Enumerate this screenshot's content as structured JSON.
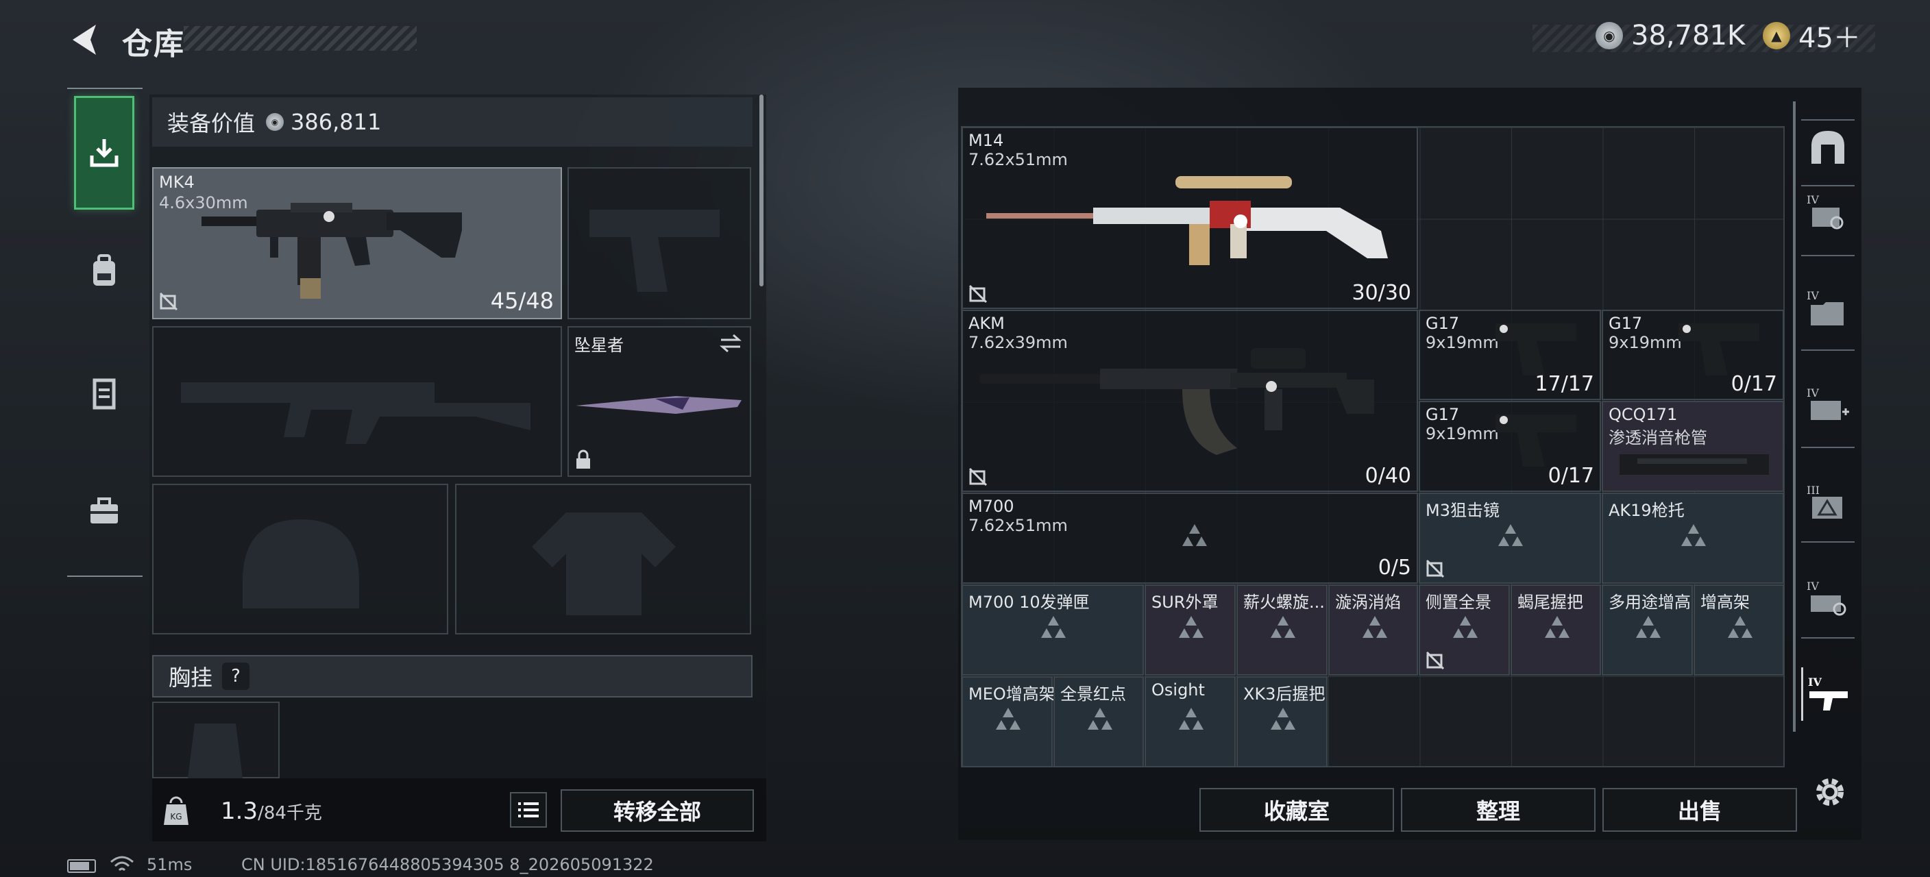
{
  "header": {
    "title": "仓库",
    "currency_a": "38,781K",
    "currency_b": "45＋"
  },
  "left": {
    "equip_value_label": "装备价值",
    "equip_value": "386,811",
    "primary": {
      "name": "MK4",
      "caliber": "4.6x30mm",
      "ammo": "45/48"
    },
    "melee": {
      "name": "坠星者"
    },
    "chest_label": "胸挂",
    "chest_help": "?",
    "weight_current": "1.3",
    "weight_max": "/84千克",
    "transfer_all": "转移全部"
  },
  "right": {
    "items": {
      "m14": {
        "name": "M14",
        "caliber": "7.62x51mm",
        "ammo": "30/30"
      },
      "akm": {
        "name": "AKM",
        "caliber": "7.62x39mm",
        "ammo": "0/40"
      },
      "g17a": {
        "name": "G17",
        "caliber": "9x19mm",
        "ammo": "17/17"
      },
      "g17b": {
        "name": "G17",
        "caliber": "9x19mm",
        "ammo": "0/17"
      },
      "g17c": {
        "name": "G17",
        "caliber": "9x19mm",
        "ammo": "0/17"
      },
      "qcq": {
        "name": "QCQ171",
        "desc": "渗透消音枪管"
      },
      "m700": {
        "name": "M700",
        "caliber": "7.62x51mm",
        "ammo": "0/5"
      },
      "m3": {
        "name": "M3狙击镜"
      },
      "ak19": {
        "name": "AK19枪托"
      },
      "m700mag": {
        "name": "M700 10发弹匣"
      },
      "sur": {
        "name": "SUR外罩"
      },
      "xinhuo": {
        "name": "薪火螺旋..."
      },
      "xuanwo": {
        "name": "漩涡消焰"
      },
      "cezhi": {
        "name": "侧置全景"
      },
      "xiewei": {
        "name": "蝎尾握把"
      },
      "duoyong": {
        "name": "多用途增高"
      },
      "zenggao": {
        "name": "增高架"
      },
      "meo": {
        "name": "MEO增高架"
      },
      "quanjing": {
        "name": "全景红点"
      },
      "osight": {
        "name": "Osight"
      },
      "xk3": {
        "name": "XK3后握把"
      }
    },
    "buttons": {
      "collection": "收藏室",
      "sort": "整理",
      "sell": "出售"
    }
  },
  "status": {
    "ping": "51ms",
    "uid": "CN UID:1851676448805394305 8_202605091322"
  },
  "colors": {
    "active_nav": "#1f5c3a",
    "active_border": "#4fbf78",
    "mod_blue": "#253038",
    "mod_purple": "#2b2a36",
    "selected_slot": "#565c63"
  },
  "icons": [
    "back-arrow-icon",
    "silver-coin-icon",
    "gold-coin-icon",
    "deposit-icon",
    "backpack-icon",
    "vest-icon",
    "toolbox-icon",
    "weight-icon",
    "list-icon",
    "settings-icon",
    "lock-icon",
    "swap-icon",
    "no-trade-icon"
  ]
}
